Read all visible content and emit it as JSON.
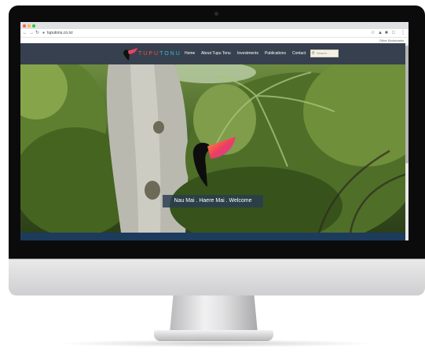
{
  "browser": {
    "url": "tuputonu.co.nz",
    "bookmarks_label": "Other Bookmarks"
  },
  "site": {
    "logo_part1": "TUPU",
    "logo_part2": "TONU",
    "nav": [
      "Home",
      "About Tupu Tonu",
      "Investments",
      "Publications",
      "Contact"
    ],
    "search_placeholder": "Search..."
  },
  "hero": {
    "caption": "Nau Mai . Haere Mai . Welcome"
  },
  "colors": {
    "header": "#37404e",
    "logo_orange": "#f0563e",
    "logo_teal": "#38b9d9",
    "bottom_band": "#1d3b5c"
  }
}
